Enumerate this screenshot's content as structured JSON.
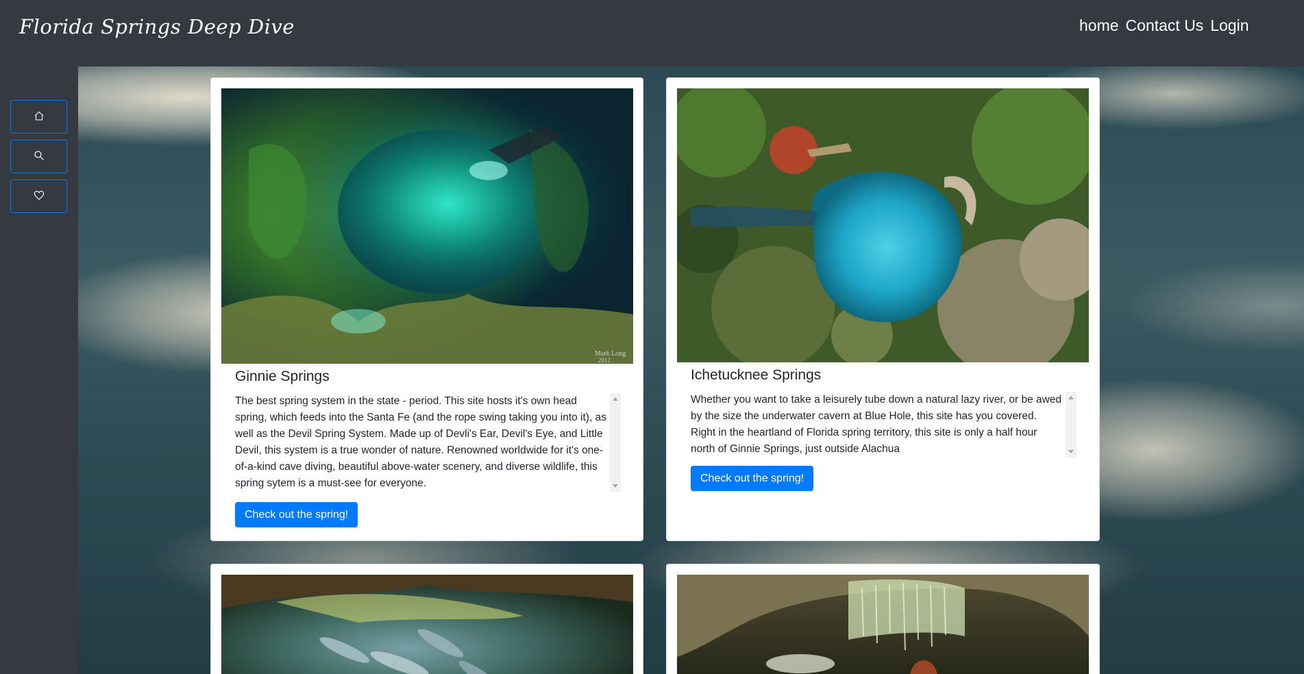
{
  "navbar": {
    "brand": "Florida Springs Deep Dive",
    "links": [
      "home",
      "Contact Us",
      "Login"
    ]
  },
  "sidebar": {
    "buttons": [
      {
        "icon": "house-icon"
      },
      {
        "icon": "search-icon"
      },
      {
        "icon": "heart-icon"
      }
    ]
  },
  "cards": [
    {
      "title": "Ginnie Springs",
      "text": "The best spring system in the state - period. This site hosts it's own head spring, which feeds into the Santa Fe (and the rope swing taking you into it), as well as the Devil Spring System. Made up of Devli's Ear, Devil's Eye, and Little Devil, this system is a true wonder of nature. Renowned worldwide for it's one-of-a-kind cave diving, beautiful above-water scenery, and diverse wildlife, this spring sytem is a must-see for everyone.",
      "button": "Check out the spring!",
      "watermark": "Mark Long 2012"
    },
    {
      "title": "Ichetucknee Springs",
      "text": "Whether you want to take a leisurely tube down a natural lazy river, or be awed by the size the underwater cavern at Blue Hole, this site has you covered. Right in the heartland of Florida spring territory, this site is only a half hour north of Ginnie Springs, just outside Alachua",
      "button": "Check out the spring!"
    }
  ],
  "colors": {
    "navbar_bg": "#343a40",
    "primary": "#007bff",
    "card_bg": "#ffffff"
  }
}
